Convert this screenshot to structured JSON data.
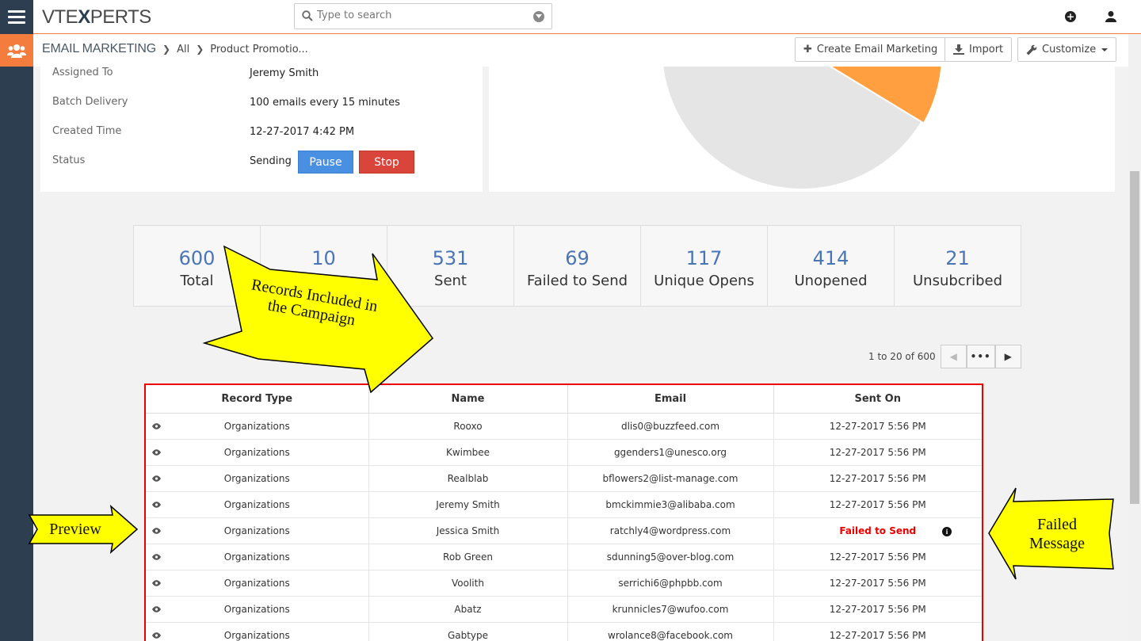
{
  "topbar": {
    "logo_left": "VTE",
    "logo_x": "X",
    "logo_right": "PERTS",
    "search_placeholder": "Type to search"
  },
  "breadcrumb": {
    "module": "EMAIL MARKETING",
    "all": "All",
    "record": "Product Promotio..."
  },
  "header_buttons": {
    "create": "Create Email Marketing",
    "import": "Import",
    "customize": "Customize"
  },
  "details": [
    {
      "label": "Assigned To",
      "value": "Jeremy Smith"
    },
    {
      "label": "Batch Delivery",
      "value": "100 emails every 15 minutes"
    },
    {
      "label": "Created Time",
      "value": "12-27-2017 4:42 PM"
    },
    {
      "label": "Status",
      "value": "Sending"
    }
  ],
  "status_buttons": {
    "pause": "Pause",
    "stop": "Stop"
  },
  "stats": [
    {
      "num": "600",
      "label": "Total"
    },
    {
      "num": "10",
      "label": ""
    },
    {
      "num": "531",
      "label": "Sent"
    },
    {
      "num": "69",
      "label": "Failed to Send"
    },
    {
      "num": "117",
      "label": "Unique Opens"
    },
    {
      "num": "414",
      "label": "Unopened"
    },
    {
      "num": "21",
      "label": "Unsubcribed"
    }
  ],
  "pagination": {
    "info": "1 to 20 of 600",
    "more": "•••"
  },
  "table": {
    "headers": [
      "Record Type",
      "Name",
      "Email",
      "Sent On"
    ],
    "rows": [
      [
        "Organizations",
        "Rooxo",
        "dlis0@buzzfeed.com",
        "12-27-2017 5:56 PM"
      ],
      [
        "Organizations",
        "Kwimbee",
        "ggenders1@unesco.org",
        "12-27-2017 5:56 PM"
      ],
      [
        "Organizations",
        "Realblab",
        "bflowers2@list-manage.com",
        "12-27-2017 5:56 PM"
      ],
      [
        "Organizations",
        "Jeremy Smith",
        "bmckimmie3@alibaba.com",
        "12-27-2017 5:56 PM"
      ],
      [
        "Organizations",
        "Jessica Smith",
        "ratchly4@wordpress.com",
        "Failed to Send"
      ],
      [
        "Organizations",
        "Rob Green",
        "sdunning5@over-blog.com",
        "12-27-2017 5:56 PM"
      ],
      [
        "Organizations",
        "Voolith",
        "serrichi6@phpbb.com",
        "12-27-2017 5:56 PM"
      ],
      [
        "Organizations",
        "Abatz",
        "krunnicles7@wufoo.com",
        "12-27-2017 5:56 PM"
      ],
      [
        "Organizations",
        "Gabtype",
        "wrolance8@facebook.com",
        "12-27-2017 5:56 PM"
      ]
    ]
  },
  "annotations": {
    "records": "Records Included in the Campaign",
    "preview": "Preview",
    "failed": "Failed Message"
  },
  "colors": {
    "accent": "#f47c3c",
    "sidebar": "#2d3e50",
    "pie_main": "#e5e5e5",
    "pie_slice": "#ff9f40",
    "callout": "#ffff00",
    "highlight_border": "#ee0000"
  }
}
